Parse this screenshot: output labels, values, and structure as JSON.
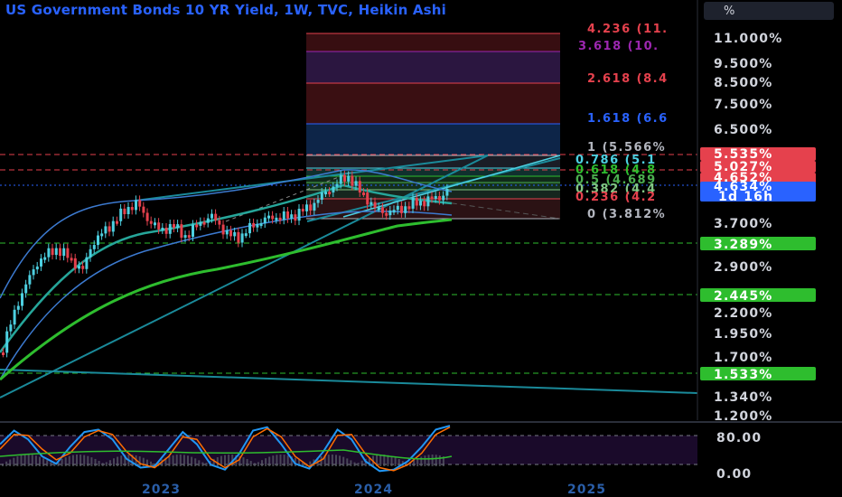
{
  "title": "US Government Bonds 10 YR Yield, 1W, TVC, Heikin Ashi",
  "unit_button": "%",
  "colors": {
    "title": "#2962ff",
    "axis_text": "#d1d4dc",
    "fib_zone_red": "#3a0f12",
    "fib_zone_purple": "#2b1640",
    "fib_zone_blue": "#0d2548",
    "ema_green": "#2ebd2e",
    "trendline": "#1aa0b0",
    "candle_up": "#4dd0e1",
    "candle_down": "#e5414d",
    "stoch_k": "#2196f3",
    "stoch_d": "#ff6d00"
  },
  "chart_data": [
    {
      "type": "candlestick",
      "title": "US Government Bonds 10 YR Yield, 1W, TVC, Heikin Ashi",
      "y_axis": {
        "scale": "log",
        "tick_labels": [
          "11.000%",
          "9.500%",
          "8.500%",
          "7.500%",
          "6.500%",
          "3.700%",
          "2.900%",
          "2.200%",
          "1.950%",
          "1.700%",
          "1.340%",
          "1.200%"
        ]
      },
      "x_axis": {
        "tick_labels": [
          "2023",
          "2024",
          "2025"
        ]
      },
      "price_badges": [
        {
          "label": "5.535%",
          "color": "#e5414d"
        },
        {
          "label": "5.027%",
          "color": "#e5414d"
        },
        {
          "label": "4.652%",
          "color": "#e5414d"
        },
        {
          "label": "4.634%",
          "color": "#2962ff"
        },
        {
          "label": "1d 16h",
          "color": "#2962ff"
        },
        {
          "label": "3.289%",
          "color": "#2ebd2e"
        },
        {
          "label": "2.445%",
          "color": "#2ebd2e"
        },
        {
          "label": "1.533%",
          "color": "#2ebd2e"
        }
      ],
      "fib_levels": [
        {
          "label": "4.236 (11.",
          "color": "#e5414d"
        },
        {
          "label": "3.618 (10.",
          "color": "#9c27b0"
        },
        {
          "label": "2.618 (8.4",
          "color": "#e5414d"
        },
        {
          "label": "1.618 (6.6",
          "color": "#2962ff"
        },
        {
          "label": "1 (5.566%",
          "color": "#b2b5be"
        },
        {
          "label": "0.786 (5.1",
          "color": "#4dd0e1"
        },
        {
          "label": "0.618 (4.8",
          "color": "#2ebd2e"
        },
        {
          "label": "0.5 (4.689",
          "color": "#4caf50"
        },
        {
          "label": "0.382 (4.4",
          "color": "#81c784"
        },
        {
          "label": "0.236 (4.2",
          "color": "#e5414d"
        },
        {
          "label": "0 (3.812%",
          "color": "#b2b5be"
        }
      ]
    },
    {
      "type": "line",
      "title": "Stochastic RSI",
      "y_axis": {
        "tick_labels": [
          "80.00",
          "0.00"
        ]
      },
      "series": [
        {
          "color": "#2196f3",
          "values": [
            60,
            88,
            70,
            35,
            20,
            55,
            85,
            90,
            70,
            30,
            12,
            15,
            50,
            85,
            60,
            18,
            8,
            40,
            88,
            95,
            60,
            20,
            10,
            45,
            90,
            70,
            25,
            5,
            8,
            25,
            55,
            90,
            98
          ]
        },
        {
          "color": "#ff6d00",
          "values": [
            50,
            80,
            78,
            50,
            28,
            42,
            75,
            88,
            80,
            45,
            20,
            12,
            35,
            75,
            70,
            30,
            12,
            28,
            75,
            92,
            75,
            35,
            14,
            30,
            78,
            80,
            40,
            12,
            6,
            18,
            42,
            80,
            95
          ]
        }
      ]
    }
  ]
}
